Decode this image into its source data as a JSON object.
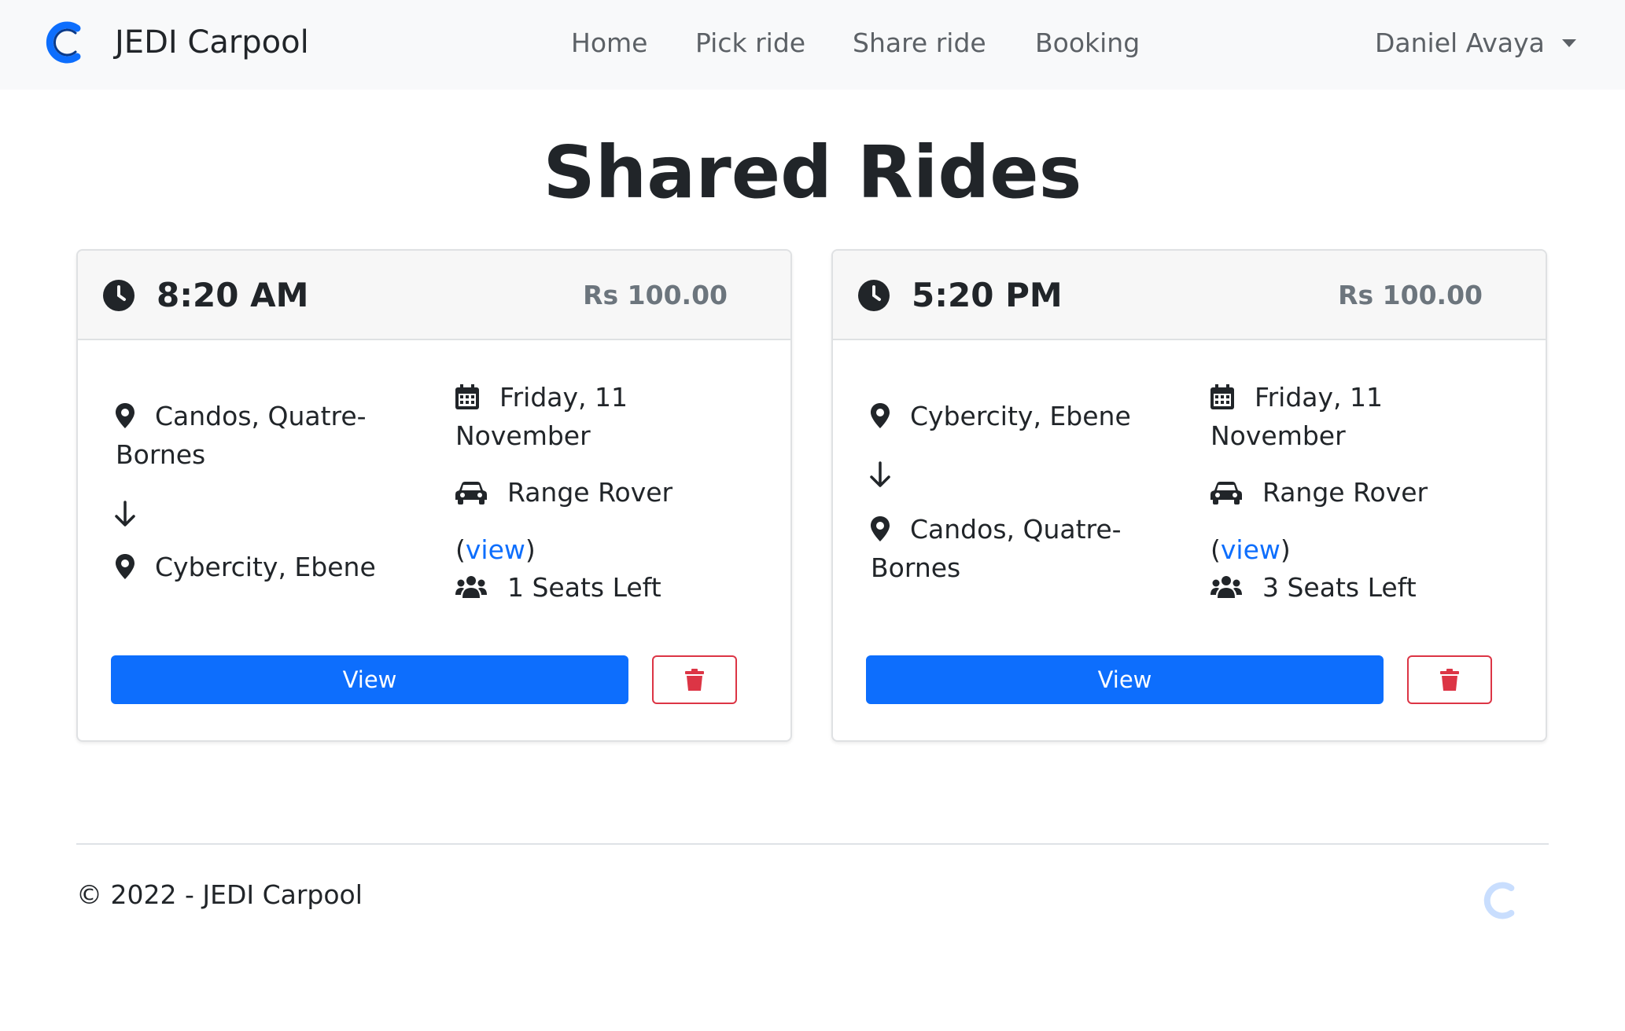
{
  "navbar": {
    "brand": "JEDI Carpool",
    "links": [
      "Home",
      "Pick ride",
      "Share ride",
      "Booking"
    ],
    "user": "Daniel Avaya"
  },
  "page": {
    "title": "Shared Rides"
  },
  "rides": [
    {
      "time": "8:20 AM",
      "price": "Rs 100.00",
      "from_line1": "Candos, Quatre-",
      "from_line2": "Bornes",
      "to_line1": "Cybercity, Ebene",
      "to_line2": "",
      "date_line1": "Friday, 11",
      "date_line2": "November",
      "vehicle": "Range Rover",
      "view_link": "view",
      "seats": "1 Seats Left",
      "view_button": "View"
    },
    {
      "time": "5:20 PM",
      "price": "Rs 100.00",
      "from_line1": "Cybercity, Ebene",
      "from_line2": "",
      "to_line1": "Candos, Quatre-",
      "to_line2": "Bornes",
      "date_line1": "Friday, 11",
      "date_line2": "November",
      "vehicle": "Range Rover",
      "view_link": "view",
      "seats": "3 Seats Left",
      "view_button": "View"
    }
  ],
  "footer": {
    "text": "© 2022 - JEDI Carpool"
  },
  "icons": {
    "logo": "crescent-c-logo",
    "time": "clock-icon",
    "location": "map-pin-icon",
    "direction": "arrow-down-icon",
    "date": "calendar-icon",
    "vehicle": "car-icon",
    "seats": "users-icon",
    "delete": "trash-icon"
  },
  "colors": {
    "primary": "#0d6efd",
    "danger": "#dc3545",
    "logo_blue": "#0d6efd",
    "logo_dark": "#0a3a8a"
  }
}
